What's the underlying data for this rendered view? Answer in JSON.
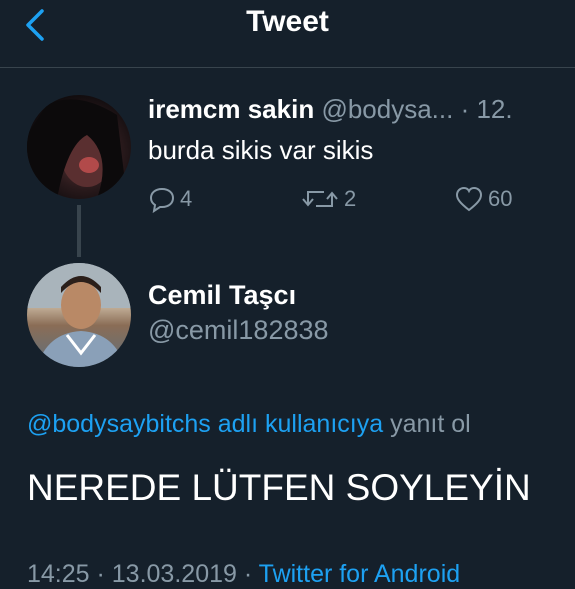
{
  "header": {
    "title": "Tweet"
  },
  "original_tweet": {
    "name": "iremcm sakin",
    "handle": "@bodysa...",
    "time": "· 12.",
    "text": "burda sikis var sikis",
    "replies": "4",
    "retweets": "2",
    "likes": "60"
  },
  "reply": {
    "name": "Cemil Taşcı",
    "handle": "@cemil182838",
    "reply_to_link": "@bodysaybitchs adlı kullanıcıya",
    "reply_to_suffix": " yanıt ol",
    "text": "NEREDE LÜTFEN SOYLEYİN",
    "time": "14:25 · 13.03.2019 · ",
    "client": "Twitter for Android"
  },
  "colors": {
    "background": "#15202b",
    "accent": "#1da1f2",
    "muted": "#8899a6",
    "divider": "#38444d"
  },
  "icons": [
    "back-icon",
    "reply-icon",
    "retweet-icon",
    "like-icon"
  ]
}
